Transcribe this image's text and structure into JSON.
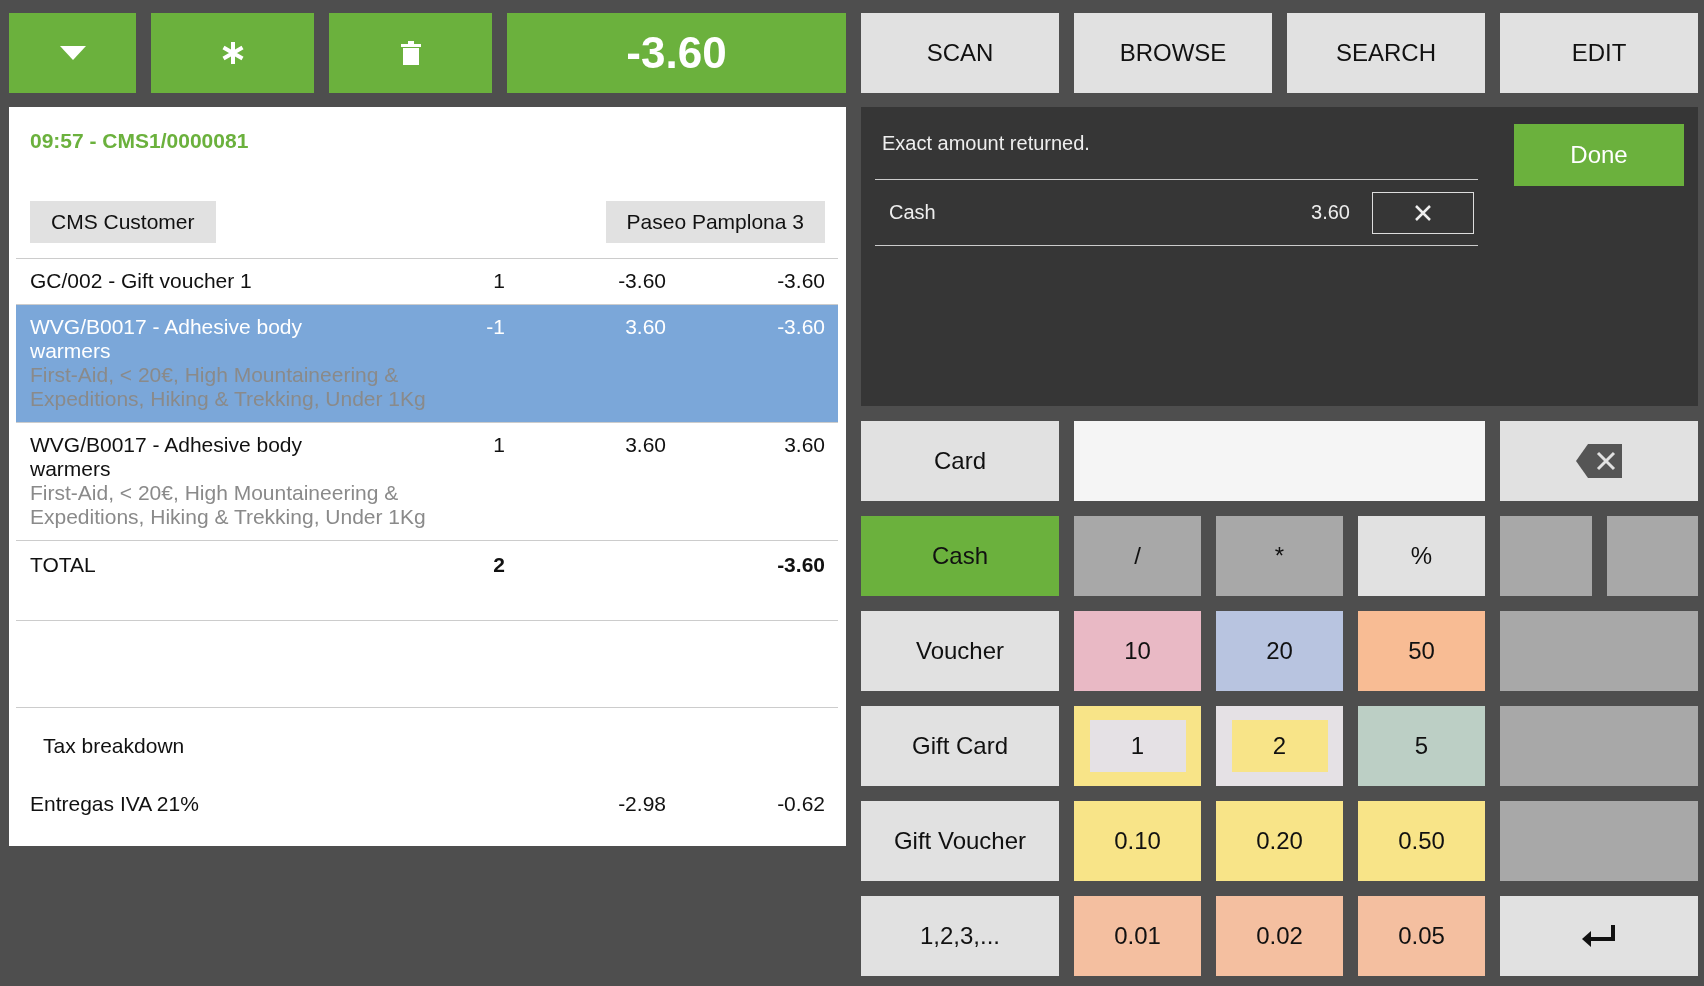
{
  "toolbar": {
    "buttons": [
      {
        "kind": "menu"
      },
      {
        "kind": "asterisk"
      },
      {
        "kind": "delete"
      }
    ],
    "total": "-3.60"
  },
  "receipt": {
    "header": "09:57 - CMS1/0000081",
    "customer": "CMS Customer",
    "location": "Paseo Pamplona 3",
    "lines": [
      {
        "product": "GC/002 - Gift voucher 1",
        "qty": "1",
        "price": "-3.60",
        "amount": "-3.60",
        "selected": false
      },
      {
        "product": "WVG/B0017 - Adhesive body warmers",
        "attributes": "First-Aid, < 20€, High Mountaineering & Expeditions, Hiking & Trekking, Under 1Kg",
        "qty": "-1",
        "price": "3.60",
        "amount": "-3.60",
        "selected": true
      },
      {
        "product": "WVG/B0017 - Adhesive body warmers",
        "attributes": "First-Aid, < 20€, High Mountaineering & Expeditions, Hiking & Trekking, Under 1Kg",
        "qty": "1",
        "price": "3.60",
        "amount": "3.60",
        "selected": false
      }
    ],
    "total": {
      "label": "TOTAL",
      "qty": "2",
      "amount": "-3.60"
    },
    "tax": {
      "title": "Tax breakdown",
      "rows": [
        {
          "name": "Entregas IVA 21%",
          "base": "-2.98",
          "amount": "-0.62"
        }
      ]
    }
  },
  "nav": [
    "SCAN",
    "BROWSE",
    "SEARCH",
    "EDIT"
  ],
  "payment": {
    "message": "Exact amount returned.",
    "done": "Done",
    "entries": [
      {
        "method": "Cash",
        "amount": "3.60"
      }
    ]
  },
  "keypad": {
    "methods": [
      {
        "label": "Card",
        "selected": false
      },
      {
        "label": "Cash",
        "selected": true
      },
      {
        "label": "Voucher",
        "selected": false
      },
      {
        "label": "Gift Card",
        "selected": false
      },
      {
        "label": "Gift Voucher",
        "selected": false
      },
      {
        "label": "1,2,3,...",
        "selected": false
      }
    ],
    "keys": [
      {
        "label": "/",
        "color": "#a8a8a8"
      },
      {
        "label": "*",
        "color": "#a8a8a8"
      },
      {
        "label": "%",
        "color": "#e1e1e1"
      },
      {
        "label": "10",
        "color": "#e9b9c5"
      },
      {
        "label": "20",
        "color": "#b8c4e0"
      },
      {
        "label": "50",
        "color": "#f8bc94"
      },
      {
        "label": "1",
        "color": "#f8e488",
        "inset": {
          "color": "#e5e1e5"
        }
      },
      {
        "label": "2",
        "color": "#e5e1e5",
        "inset": {
          "color": "#f8e488"
        }
      },
      {
        "label": "5",
        "color": "#bccfc5"
      },
      {
        "label": "0.10",
        "color": "#f8e488"
      },
      {
        "label": "0.20",
        "color": "#f8e488"
      },
      {
        "label": "0.50",
        "color": "#f8e488"
      },
      {
        "label": "0.01",
        "color": "#f4bfa0"
      },
      {
        "label": "0.02",
        "color": "#f4bfa0"
      },
      {
        "label": "0.05",
        "color": "#f4bfa0"
      }
    ],
    "side": [
      {
        "kind": "backspace"
      },
      {
        "kind": "split"
      },
      {
        "kind": "blank"
      },
      {
        "kind": "blank"
      },
      {
        "kind": "blank"
      },
      {
        "kind": "enter"
      }
    ]
  }
}
